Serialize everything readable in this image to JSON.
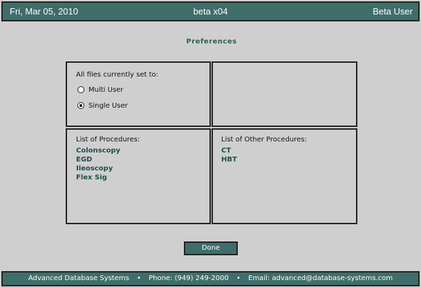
{
  "header": {
    "date": "Fri, Mar 05, 2010",
    "title": "beta x04",
    "user": "Beta User"
  },
  "page_title": "Preferences",
  "file_settings": {
    "label": "All files currently set to:",
    "options": [
      {
        "label": "Multi User",
        "selected": false
      },
      {
        "label": "Single User",
        "selected": true
      }
    ]
  },
  "procedures": {
    "label": "List of Procedures:",
    "items": [
      "Colonscopy",
      "EGD",
      "Ileoscopy",
      "Flex Sig"
    ]
  },
  "other_procedures": {
    "label": "List of Other Procedures:",
    "items": [
      "CT",
      "HBT"
    ]
  },
  "done_label": "Done",
  "footer": {
    "company": "Advanced Database Systems",
    "separator": "•",
    "phone": "Phone: (949) 249-2000",
    "email": "Email: advanced@database-systems.com"
  },
  "colors": {
    "bar": "#3f6e6a",
    "background": "#cfcfcf",
    "accent_text": "#1f4f4b"
  }
}
